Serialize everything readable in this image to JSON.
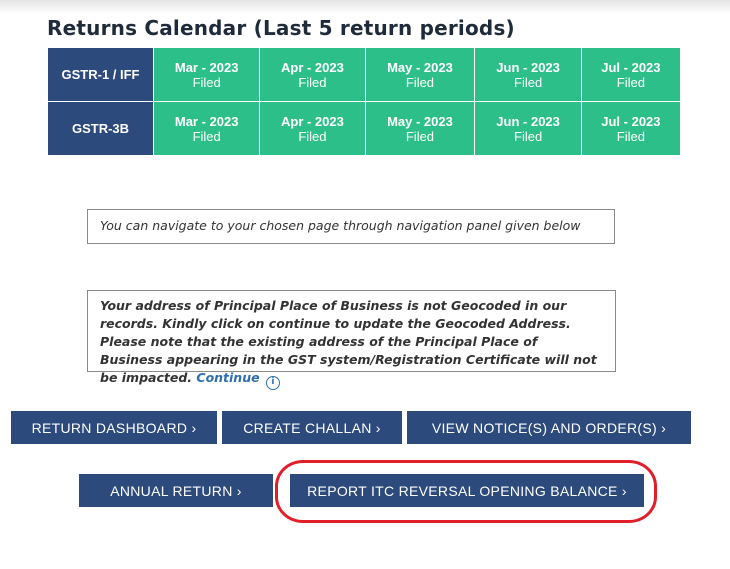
{
  "calendar": {
    "title": "Returns Calendar (Last 5 return periods)",
    "rows": [
      {
        "label": "GSTR-1 / IFF",
        "cells": [
          {
            "month": "Mar - 2023",
            "status": "Filed"
          },
          {
            "month": "Apr - 2023",
            "status": "Filed"
          },
          {
            "month": "May - 2023",
            "status": "Filed"
          },
          {
            "month": "Jun - 2023",
            "status": "Filed"
          },
          {
            "month": "Jul - 2023",
            "status": "Filed"
          }
        ]
      },
      {
        "label": "GSTR-3B",
        "cells": [
          {
            "month": "Mar - 2023",
            "status": "Filed"
          },
          {
            "month": "Apr - 2023",
            "status": "Filed"
          },
          {
            "month": "May - 2023",
            "status": "Filed"
          },
          {
            "month": "Jun - 2023",
            "status": "Filed"
          },
          {
            "month": "Jul - 2023",
            "status": "Filed"
          }
        ]
      }
    ],
    "colors": {
      "row_header": "#2c4a7c",
      "filed": "#2dbf8a"
    }
  },
  "navigation_note": "You can navigate to your chosen page through navigation panel given below",
  "geocode_note": {
    "text": "Your address of Principal Place of Business is not Geocoded in our records. Kindly click on continue to update the Geocoded Address. Please note that the existing address of the Principal Place of Business appearing in the GST system/Registration Certificate will not be impacted.",
    "continue_label": "Continue",
    "icon": "info-icon"
  },
  "buttons": {
    "return_dashboard": "RETURN DASHBOARD ›",
    "create_challan": "CREATE CHALLAN ›",
    "view_notices": "VIEW NOTICE(S) AND ORDER(S) ›",
    "annual_return": "ANNUAL RETURN ›",
    "report_itc": "REPORT ITC REVERSAL OPENING BALANCE ›"
  },
  "colors": {
    "button": "#2c4a7c",
    "highlight": "#e01f2a",
    "link": "#2d6fb2"
  }
}
